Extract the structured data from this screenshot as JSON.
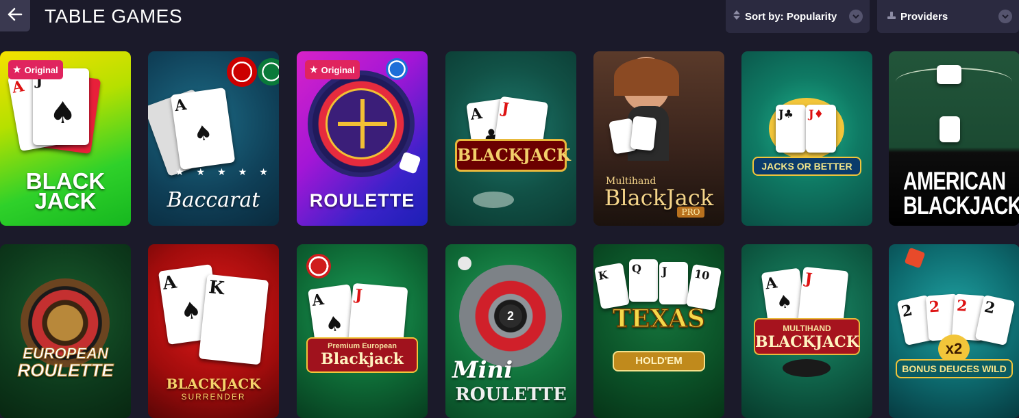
{
  "header": {
    "title": "TABLE GAMES",
    "sort_label": "Sort by: Popularity",
    "providers_label": "Providers"
  },
  "icons": {
    "back": "arrow-left-icon",
    "sort": "sort-arrows-icon",
    "providers": "providers-icon",
    "chevron": "chevron-down-icon",
    "badge": "star-icon"
  },
  "colors": {
    "background": "#1b1a2a",
    "control": "#2b2a40",
    "badge": "#e0245e"
  },
  "games": [
    {
      "title_line1": "BLACK",
      "title_line2": "JACK",
      "badge": "Original"
    },
    {
      "title": "Baccarat"
    },
    {
      "title": "ROULETTE",
      "badge": "Original"
    },
    {
      "title": "BLACKJACK"
    },
    {
      "pre": "Multihand",
      "title": "BlackJack",
      "sub": "PRO"
    },
    {
      "title": "JACKS OR BETTER"
    },
    {
      "title_line1": "AMERICAN",
      "title_line2": "BLACKJACK"
    },
    {
      "title_line1": "EUROPEAN",
      "title_line2": "ROULETTE"
    },
    {
      "title": "BLACKJACK",
      "sub": "SURRENDER"
    },
    {
      "pre": "Premium European",
      "title": "Blackjack"
    },
    {
      "title_line1": "Mini",
      "title_line2": "ROULETTE"
    },
    {
      "title": "TEXAS",
      "sub": "HOLD'EM"
    },
    {
      "pre": "MULTIHAND",
      "title": "BLACKJACK"
    },
    {
      "badge": "x2",
      "title": "BONUS DEUCES WILD"
    }
  ]
}
